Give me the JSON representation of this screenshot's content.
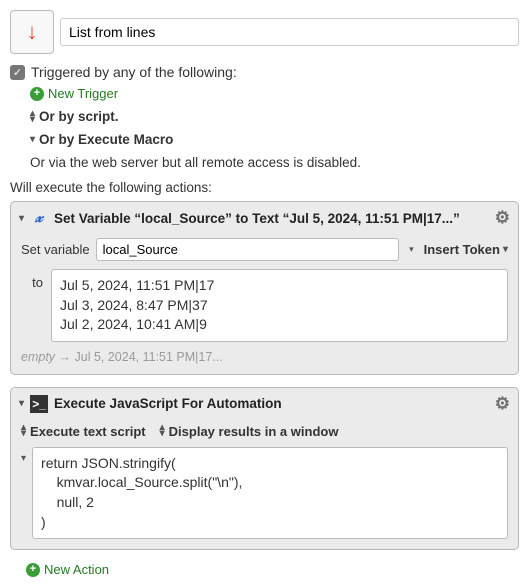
{
  "header": {
    "title_value": "List from lines"
  },
  "triggers": {
    "header": "Triggered by any of the following:",
    "new_trigger": "New Trigger",
    "by_script": "Or by script.",
    "by_execute_macro": "Or by Execute Macro",
    "web_server": "Or via the web server but all remote access is disabled."
  },
  "actions_header": "Will execute the following actions:",
  "action_setvar": {
    "title": "Set Variable “local_Source” to Text “Jul 5, 2024, 11:51 PM|17...”",
    "setvar_label": "Set variable",
    "var_name": "local_Source",
    "insert_token": "Insert Token",
    "to_label": "to",
    "text_value": "Jul 5, 2024, 11:51 PM|17\nJul 3, 2024, 8:47 PM|37\nJul 2, 2024, 10:41 AM|9",
    "empty_preview_prefix": "empty",
    "empty_preview_rest": " → Jul 5, 2024, 11:51 PM|17..."
  },
  "action_js": {
    "title": "Execute JavaScript For Automation",
    "exec_script": "Execute text script",
    "display_results": "Display results in a window",
    "code": "return JSON.stringify(\n    kmvar.local_Source.split(\"\\n\"),\n    null, 2\n)"
  },
  "new_action": "New Action"
}
